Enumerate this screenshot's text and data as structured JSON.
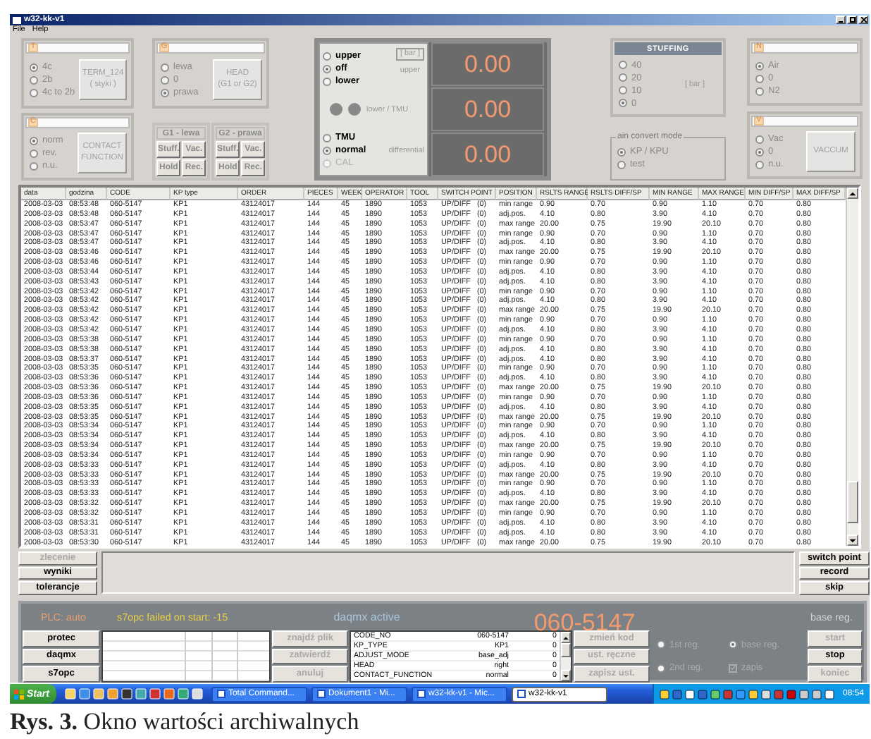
{
  "window": {
    "title": "w32-kk-v1",
    "menu": [
      "File",
      "Help"
    ]
  },
  "t_panel": {
    "letter": "T",
    "options": [
      {
        "label": "4c",
        "selected": true
      },
      {
        "label": "2b",
        "selected": false
      },
      {
        "label": "4c to 2b",
        "selected": false
      }
    ],
    "button": [
      "TERM_124",
      "( styki )"
    ]
  },
  "c_panel": {
    "letter": "C",
    "options": [
      {
        "label": "norm",
        "selected": true
      },
      {
        "label": "rev.",
        "selected": false
      },
      {
        "label": "n.u.",
        "selected": false
      }
    ],
    "button": [
      "CONTACT",
      "FUNCTION"
    ]
  },
  "g_panel": {
    "letter": "G",
    "options": [
      {
        "label": "lewa",
        "selected": false
      },
      {
        "label": "0",
        "selected": false
      },
      {
        "label": "prawa",
        "selected": true
      }
    ],
    "button": [
      "HEAD",
      "(G1 or G2)"
    ]
  },
  "heads": [
    {
      "title": "G1 - lewa",
      "buttons": [
        "Stuff.",
        "Vac.",
        "Hold",
        "Rec."
      ]
    },
    {
      "title": "G2 - prawa",
      "buttons": [
        "Stuff.",
        "Vac.",
        "Hold",
        "Rec."
      ]
    }
  ],
  "display": {
    "upper_options": [
      {
        "label": "upper",
        "selected": false
      },
      {
        "label": "off",
        "selected": true
      },
      {
        "label": "lower",
        "selected": false
      }
    ],
    "unit": "[ bar ]",
    "upper_label": "upper",
    "indicators": [
      {
        "on": false
      },
      {
        "on": false
      }
    ],
    "indicators_label": "lower / TMU",
    "mode_options": [
      {
        "label": "TMU",
        "selected": false,
        "disabled": false
      },
      {
        "label": "normal",
        "selected": true,
        "disabled": false
      },
      {
        "label": "CAL",
        "selected": false,
        "disabled": true
      }
    ],
    "differential_label": "differential",
    "readings": [
      "0.00",
      "0.00",
      "0.00"
    ]
  },
  "stuffing": {
    "title": "STUFFING",
    "options": [
      {
        "label": "40",
        "selected": false
      },
      {
        "label": "20",
        "selected": false
      },
      {
        "label": "10",
        "selected": false
      },
      {
        "label": "0",
        "selected": true
      }
    ],
    "unit": "[ bar ]"
  },
  "convert_mode": {
    "title": "ain convert mode",
    "options": [
      {
        "label": "KP / KPU",
        "selected": true
      },
      {
        "label": "test",
        "selected": false
      }
    ]
  },
  "n_panel": {
    "letter": "N",
    "options": [
      {
        "label": "Air",
        "selected": true
      },
      {
        "label": "0",
        "selected": false
      },
      {
        "label": "N2",
        "selected": false
      }
    ]
  },
  "v_panel": {
    "letter": "V",
    "options": [
      {
        "label": "Vac",
        "selected": false
      },
      {
        "label": "0",
        "selected": true
      },
      {
        "label": "n.u.",
        "selected": false
      }
    ],
    "button": [
      "VACCUM"
    ]
  },
  "table": {
    "columns": [
      "data",
      "godzina",
      "CODE",
      "KP type",
      "ORDER",
      "PIECES",
      "WEEK",
      "OPERATOR",
      "TOOL",
      "SWITCH POINT",
      "POSITION",
      "RSLTS RANGE",
      "RSLTS DIFF/SP",
      "MIN RANGE",
      "MAX RANGE",
      "MIN DIFF/SP",
      "MAX DIFF/SP"
    ],
    "rows": [
      [
        "2008-03-03",
        "08:53:48",
        "060-5147",
        "KP1",
        "43124017",
        "144",
        "45",
        "1890",
        "1053",
        "UP/DIFF   (0)",
        "min range",
        "0.90",
        "0.70",
        "0.90",
        "1.10",
        "0.70",
        "0.80"
      ],
      [
        "2008-03-03",
        "08:53:48",
        "060-5147",
        "KP1",
        "43124017",
        "144",
        "45",
        "1890",
        "1053",
        "UP/DIFF   (0)",
        "adj.pos.",
        "4.10",
        "0.80",
        "3.90",
        "4.10",
        "0.70",
        "0.80"
      ],
      [
        "2008-03-03",
        "08:53:47",
        "060-5147",
        "KP1",
        "43124017",
        "144",
        "45",
        "1890",
        "1053",
        "UP/DIFF   (0)",
        "max range",
        "20.00",
        "0.75",
        "19.90",
        "20.10",
        "0.70",
        "0.80"
      ],
      [
        "2008-03-03",
        "08:53:47",
        "060-5147",
        "KP1",
        "43124017",
        "144",
        "45",
        "1890",
        "1053",
        "UP/DIFF   (0)",
        "min range",
        "0.90",
        "0.70",
        "0.90",
        "1.10",
        "0.70",
        "0.80"
      ],
      [
        "2008-03-03",
        "08:53:47",
        "060-5147",
        "KP1",
        "43124017",
        "144",
        "45",
        "1890",
        "1053",
        "UP/DIFF   (0)",
        "adj.pos.",
        "4.10",
        "0.80",
        "3.90",
        "4.10",
        "0.70",
        "0.80"
      ],
      [
        "2008-03-03",
        "08:53:46",
        "060-5147",
        "KP1",
        "43124017",
        "144",
        "45",
        "1890",
        "1053",
        "UP/DIFF   (0)",
        "max range",
        "20.00",
        "0.75",
        "19.90",
        "20.10",
        "0.70",
        "0.80"
      ],
      [
        "2008-03-03",
        "08:53:46",
        "060-5147",
        "KP1",
        "43124017",
        "144",
        "45",
        "1890",
        "1053",
        "UP/DIFF   (0)",
        "min range",
        "0.90",
        "0.70",
        "0.90",
        "1.10",
        "0.70",
        "0.80"
      ],
      [
        "2008-03-03",
        "08:53:44",
        "060-5147",
        "KP1",
        "43124017",
        "144",
        "45",
        "1890",
        "1053",
        "UP/DIFF   (0)",
        "adj.pos.",
        "4.10",
        "0.80",
        "3.90",
        "4.10",
        "0.70",
        "0.80"
      ],
      [
        "2008-03-03",
        "08:53:43",
        "060-5147",
        "KP1",
        "43124017",
        "144",
        "45",
        "1890",
        "1053",
        "UP/DIFF   (0)",
        "adj.pos.",
        "4.10",
        "0.80",
        "3.90",
        "4.10",
        "0.70",
        "0.80"
      ],
      [
        "2008-03-03",
        "08:53:42",
        "060-5147",
        "KP1",
        "43124017",
        "144",
        "45",
        "1890",
        "1053",
        "UP/DIFF   (0)",
        "min range",
        "0.90",
        "0.70",
        "0.90",
        "1.10",
        "0.70",
        "0.80"
      ],
      [
        "2008-03-03",
        "08:53:42",
        "060-5147",
        "KP1",
        "43124017",
        "144",
        "45",
        "1890",
        "1053",
        "UP/DIFF   (0)",
        "adj.pos.",
        "4.10",
        "0.80",
        "3.90",
        "4.10",
        "0.70",
        "0.80"
      ],
      [
        "2008-03-03",
        "08:53:42",
        "060-5147",
        "KP1",
        "43124017",
        "144",
        "45",
        "1890",
        "1053",
        "UP/DIFF   (0)",
        "max range",
        "20.00",
        "0.75",
        "19.90",
        "20.10",
        "0.70",
        "0.80"
      ],
      [
        "2008-03-03",
        "08:53:42",
        "060-5147",
        "KP1",
        "43124017",
        "144",
        "45",
        "1890",
        "1053",
        "UP/DIFF   (0)",
        "min range",
        "0.90",
        "0.70",
        "0.90",
        "1.10",
        "0.70",
        "0.80"
      ],
      [
        "2008-03-03",
        "08:53:42",
        "060-5147",
        "KP1",
        "43124017",
        "144",
        "45",
        "1890",
        "1053",
        "UP/DIFF   (0)",
        "adj.pos.",
        "4.10",
        "0.80",
        "3.90",
        "4.10",
        "0.70",
        "0.80"
      ],
      [
        "2008-03-03",
        "08:53:38",
        "060-5147",
        "KP1",
        "43124017",
        "144",
        "45",
        "1890",
        "1053",
        "UP/DIFF   (0)",
        "min range",
        "0.90",
        "0.70",
        "0.90",
        "1.10",
        "0.70",
        "0.80"
      ],
      [
        "2008-03-03",
        "08:53:38",
        "060-5147",
        "KP1",
        "43124017",
        "144",
        "45",
        "1890",
        "1053",
        "UP/DIFF   (0)",
        "adj.pos.",
        "4.10",
        "0.80",
        "3.90",
        "4.10",
        "0.70",
        "0.80"
      ],
      [
        "2008-03-03",
        "08:53:37",
        "060-5147",
        "KP1",
        "43124017",
        "144",
        "45",
        "1890",
        "1053",
        "UP/DIFF   (0)",
        "adj.pos.",
        "4.10",
        "0.80",
        "3.90",
        "4.10",
        "0.70",
        "0.80"
      ],
      [
        "2008-03-03",
        "08:53:35",
        "060-5147",
        "KP1",
        "43124017",
        "144",
        "45",
        "1890",
        "1053",
        "UP/DIFF   (0)",
        "min range",
        "0.90",
        "0.70",
        "0.90",
        "1.10",
        "0.70",
        "0.80"
      ],
      [
        "2008-03-03",
        "08:53:36",
        "060-5147",
        "KP1",
        "43124017",
        "144",
        "45",
        "1890",
        "1053",
        "UP/DIFF   (0)",
        "adj.pos.",
        "4.10",
        "0.80",
        "3.90",
        "4.10",
        "0.70",
        "0.80"
      ],
      [
        "2008-03-03",
        "08:53:36",
        "060-5147",
        "KP1",
        "43124017",
        "144",
        "45",
        "1890",
        "1053",
        "UP/DIFF   (0)",
        "max range",
        "20.00",
        "0.75",
        "19.90",
        "20.10",
        "0.70",
        "0.80"
      ],
      [
        "2008-03-03",
        "08:53:36",
        "060-5147",
        "KP1",
        "43124017",
        "144",
        "45",
        "1890",
        "1053",
        "UP/DIFF   (0)",
        "min range",
        "0.90",
        "0.70",
        "0.90",
        "1.10",
        "0.70",
        "0.80"
      ],
      [
        "2008-03-03",
        "08:53:35",
        "060-5147",
        "KP1",
        "43124017",
        "144",
        "45",
        "1890",
        "1053",
        "UP/DIFF   (0)",
        "adj.pos.",
        "4.10",
        "0.80",
        "3.90",
        "4.10",
        "0.70",
        "0.80"
      ],
      [
        "2008-03-03",
        "08:53:35",
        "060-5147",
        "KP1",
        "43124017",
        "144",
        "45",
        "1890",
        "1053",
        "UP/DIFF   (0)",
        "max range",
        "20.00",
        "0.75",
        "19.90",
        "20.10",
        "0.70",
        "0.80"
      ],
      [
        "2008-03-03",
        "08:53:34",
        "060-5147",
        "KP1",
        "43124017",
        "144",
        "45",
        "1890",
        "1053",
        "UP/DIFF   (0)",
        "min range",
        "0.90",
        "0.70",
        "0.90",
        "1.10",
        "0.70",
        "0.80"
      ],
      [
        "2008-03-03",
        "08:53:34",
        "060-5147",
        "KP1",
        "43124017",
        "144",
        "45",
        "1890",
        "1053",
        "UP/DIFF   (0)",
        "adj.pos.",
        "4.10",
        "0.80",
        "3.90",
        "4.10",
        "0.70",
        "0.80"
      ],
      [
        "2008-03-03",
        "08:53:34",
        "060-5147",
        "KP1",
        "43124017",
        "144",
        "45",
        "1890",
        "1053",
        "UP/DIFF   (0)",
        "max range",
        "20.00",
        "0.75",
        "19.90",
        "20.10",
        "0.70",
        "0.80"
      ],
      [
        "2008-03-03",
        "08:53:34",
        "060-5147",
        "KP1",
        "43124017",
        "144",
        "45",
        "1890",
        "1053",
        "UP/DIFF   (0)",
        "min range",
        "0.90",
        "0.70",
        "0.90",
        "1.10",
        "0.70",
        "0.80"
      ],
      [
        "2008-03-03",
        "08:53:33",
        "060-5147",
        "KP1",
        "43124017",
        "144",
        "45",
        "1890",
        "1053",
        "UP/DIFF   (0)",
        "adj.pos.",
        "4.10",
        "0.80",
        "3.90",
        "4.10",
        "0.70",
        "0.80"
      ],
      [
        "2008-03-03",
        "08:53:33",
        "060-5147",
        "KP1",
        "43124017",
        "144",
        "45",
        "1890",
        "1053",
        "UP/DIFF   (0)",
        "max range",
        "20.00",
        "0.75",
        "19.90",
        "20.10",
        "0.70",
        "0.80"
      ],
      [
        "2008-03-03",
        "08:53:33",
        "060-5147",
        "KP1",
        "43124017",
        "144",
        "45",
        "1890",
        "1053",
        "UP/DIFF   (0)",
        "min range",
        "0.90",
        "0.70",
        "0.90",
        "1.10",
        "0.70",
        "0.80"
      ],
      [
        "2008-03-03",
        "08:53:33",
        "060-5147",
        "KP1",
        "43124017",
        "144",
        "45",
        "1890",
        "1053",
        "UP/DIFF   (0)",
        "adj.pos.",
        "4.10",
        "0.80",
        "3.90",
        "4.10",
        "0.70",
        "0.80"
      ],
      [
        "2008-03-03",
        "08:53:32",
        "060-5147",
        "KP1",
        "43124017",
        "144",
        "45",
        "1890",
        "1053",
        "UP/DIFF   (0)",
        "max range",
        "20.00",
        "0.75",
        "19.90",
        "20.10",
        "0.70",
        "0.80"
      ],
      [
        "2008-03-03",
        "08:53:32",
        "060-5147",
        "KP1",
        "43124017",
        "144",
        "45",
        "1890",
        "1053",
        "UP/DIFF   (0)",
        "min range",
        "0.90",
        "0.70",
        "0.90",
        "1.10",
        "0.70",
        "0.80"
      ],
      [
        "2008-03-03",
        "08:53:31",
        "060-5147",
        "KP1",
        "43124017",
        "144",
        "45",
        "1890",
        "1053",
        "UP/DIFF   (0)",
        "adj.pos.",
        "4.10",
        "0.80",
        "3.90",
        "4.10",
        "0.70",
        "0.80"
      ],
      [
        "2008-03-03",
        "08:53:31",
        "060-5147",
        "KP1",
        "43124017",
        "144",
        "45",
        "1890",
        "1053",
        "UP/DIFF   (0)",
        "adj.pos.",
        "4.10",
        "0.80",
        "3.90",
        "4.10",
        "0.70",
        "0.80"
      ],
      [
        "2008-03-03",
        "08:53:30",
        "060-5147",
        "KP1",
        "43124017",
        "144",
        "45",
        "1890",
        "1053",
        "UP/DIFF   (0)",
        "max range",
        "20.00",
        "0.75",
        "19.90",
        "20.10",
        "0.70",
        "0.80"
      ]
    ]
  },
  "left_buttons": [
    {
      "label": "zlecenie",
      "disabled": true
    },
    {
      "label": "wyniki",
      "disabled": false
    },
    {
      "label": "tolerancje",
      "disabled": false
    }
  ],
  "right_buttons": [
    "switch point",
    "record",
    "skip"
  ],
  "status": {
    "plc": "PLC: auto",
    "error": "s7opc failed on start: -15",
    "daq": "daqmx active",
    "code": "060-5147",
    "mode": "base reg."
  },
  "service_buttons": [
    "protec",
    "daqmx",
    "s7opc"
  ],
  "file_buttons": [
    {
      "label": "znajdź plik",
      "disabled": true
    },
    {
      "label": "zatwierdź",
      "disabled": true
    },
    {
      "label": "anuluj",
      "disabled": true
    }
  ],
  "properties": [
    {
      "name": "CODE_NO",
      "value": "060-5147",
      "flag": "0"
    },
    {
      "name": "KP_TYPE",
      "value": "KP1",
      "flag": "0"
    },
    {
      "name": "ADJUST_MODE",
      "value": "base_adj",
      "flag": "0"
    },
    {
      "name": "HEAD",
      "value": "right",
      "flag": "0"
    },
    {
      "name": "CONTACT_FUNCTION",
      "value": "normal",
      "flag": "0"
    }
  ],
  "setting_buttons": [
    {
      "label": "zmień kod",
      "disabled": true
    },
    {
      "label": "ust. ręczne",
      "disabled": true
    },
    {
      "label": "zapisz ust.",
      "disabled": true
    }
  ],
  "reg_options": [
    {
      "label": "1st reg.",
      "selected": false
    },
    {
      "label": "base reg.",
      "selected": true
    },
    {
      "label": "2nd reg.",
      "selected": false
    }
  ],
  "save": {
    "label": "zapis",
    "checked": true
  },
  "control_buttons": [
    {
      "label": "start",
      "disabled": true
    },
    {
      "label": "stop",
      "disabled": false
    },
    {
      "label": "koniec",
      "disabled": true
    }
  ],
  "taskbar": {
    "start": "Start",
    "tasks": [
      {
        "label": "Total Command...",
        "selected": false
      },
      {
        "label": "Dokument1 - Mi...",
        "selected": false
      },
      {
        "label": "w32-kk-v1 - Mic...",
        "selected": false
      },
      {
        "label": "w32-kk-v1",
        "selected": true
      }
    ],
    "clock": "08:54"
  },
  "caption": "**Rys. 3.** Okno wartości archiwalnych"
}
